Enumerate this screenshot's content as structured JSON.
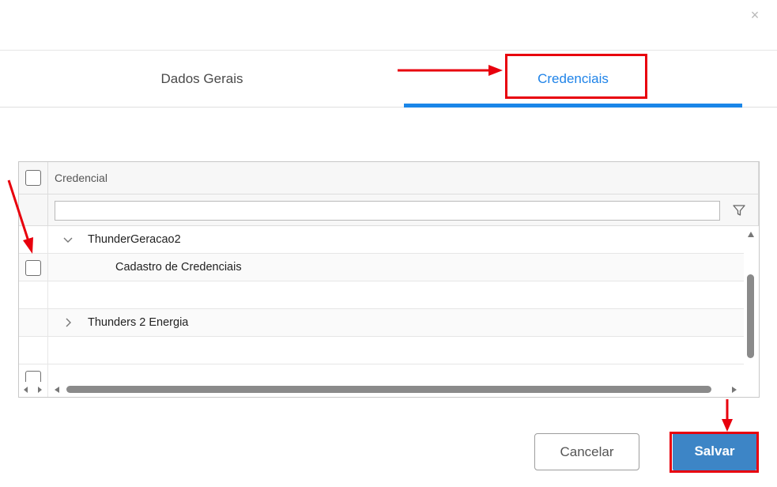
{
  "dialog": {
    "close_symbol": "×"
  },
  "tabs": [
    {
      "label": "Dados Gerais",
      "active": false
    },
    {
      "label": "Credenciais",
      "active": true
    }
  ],
  "grid": {
    "column_header": "Credencial",
    "filter_value": "",
    "rows": [
      {
        "label": "ThunderGeracao2",
        "type": "group",
        "expanded": true,
        "checkbox": false
      },
      {
        "label": "Cadastro de Credenciais",
        "type": "item",
        "checkbox": true
      },
      {
        "label": "",
        "type": "empty",
        "checkbox": false
      },
      {
        "label": "Thunders 2 Energia",
        "type": "group",
        "expanded": false,
        "checkbox": false
      },
      {
        "label": "",
        "type": "empty",
        "checkbox": false
      }
    ]
  },
  "buttons": {
    "cancel": "Cancelar",
    "save": "Salvar"
  },
  "colors": {
    "accent": "#1a86e8",
    "annotation": "#e8000d",
    "save_button": "#3d85c6"
  }
}
